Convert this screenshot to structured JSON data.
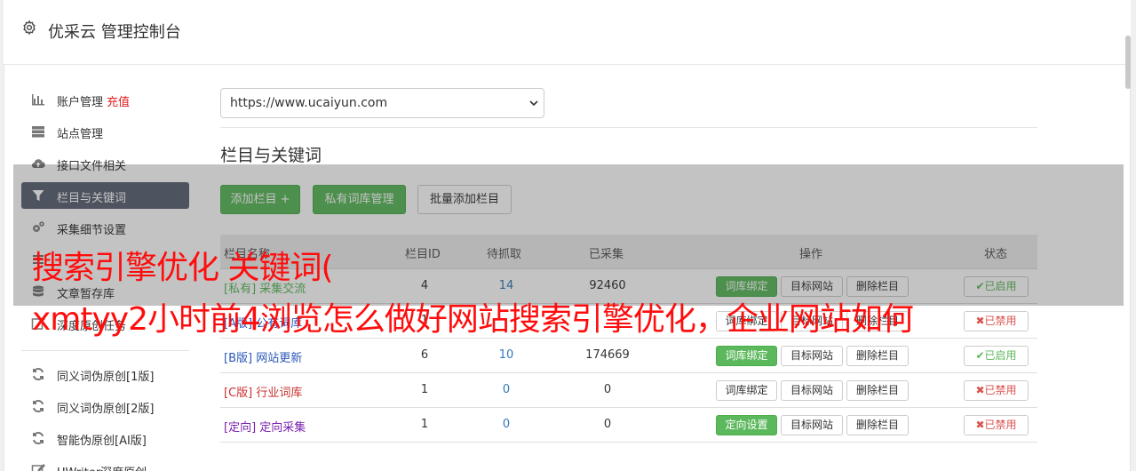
{
  "header": {
    "title": "优采云 管理控制台",
    "icon": "gear-icon"
  },
  "sidebar": {
    "items": [
      {
        "label": "账户管理",
        "extra": "充值",
        "icon": "bar-chart-icon"
      },
      {
        "label": "站点管理",
        "icon": "server-icon"
      },
      {
        "label": "接口文件相关",
        "icon": "cloud-upload-icon"
      },
      {
        "label": "栏目与关键词",
        "icon": "filter-icon",
        "active": true
      },
      {
        "label": "采集细节设置",
        "icon": "cogs-icon"
      },
      {
        "label": "",
        "icon": "list-icon"
      },
      {
        "label": "文章暂存库",
        "icon": "database-icon"
      },
      {
        "label": "深度原创任务",
        "icon": "edit-icon"
      },
      {
        "label": "同义词伪原创[1版]",
        "icon": "refresh-icon"
      },
      {
        "label": "同义词伪原创[2版]",
        "icon": "refresh-icon"
      },
      {
        "label": "智能伪原创[AI版]",
        "icon": "refresh-icon"
      },
      {
        "label": "UWriter深度原创",
        "icon": "pencil-icon"
      }
    ]
  },
  "site_select": {
    "value": "https://www.ucaiyun.com"
  },
  "section": {
    "title": "栏目与关键词"
  },
  "toolbar": {
    "add_column": "添加栏目 +",
    "private_lib": "私有词库管理",
    "batch_add": "批量添加栏目"
  },
  "table": {
    "headers": {
      "name": "栏目名称",
      "id": "栏目ID",
      "pending": "待抓取",
      "collected": "已采集",
      "ops": "操作",
      "status": "状态"
    },
    "rows": [
      {
        "tag": "[私有]",
        "name": "采集交流",
        "id": "4",
        "pending": "14",
        "collected": "92460",
        "op1": "词库绑定",
        "op1_green": true,
        "op2": "目标网站",
        "op3": "删除栏目",
        "status": "✔已启用",
        "status_on": true,
        "tag_color": "#5cb85c"
      },
      {
        "tag": "[A版]",
        "name": "公有词库",
        "id": "1",
        "pending": "",
        "collected": "",
        "op1": "词库绑定",
        "op1_green": false,
        "op2": "目标网站",
        "op3": "删除栏目",
        "status": "✖已禁用",
        "status_on": false,
        "tag_color": "#2a57b8"
      },
      {
        "tag": "[B版]",
        "name": "网站更新",
        "id": "6",
        "pending": "10",
        "collected": "174669",
        "op1": "词库绑定",
        "op1_green": true,
        "op2": "目标网站",
        "op3": "删除栏目",
        "status": "✔已启用",
        "status_on": true,
        "tag_color": "#2a57b8"
      },
      {
        "tag": "[C版]",
        "name": "行业词库",
        "id": "1",
        "pending": "0",
        "collected": "0",
        "op1": "词库绑定",
        "op1_green": false,
        "op2": "目标网站",
        "op3": "删除栏目",
        "status": "✖已禁用",
        "status_on": false,
        "tag_color": "#c9302c"
      },
      {
        "tag": "[定向]",
        "name": "定向采集",
        "id": "1",
        "pending": "0",
        "collected": "0",
        "op1": "定向设置",
        "op1_green": true,
        "op2": "目标网站",
        "op3": "删除栏目",
        "status": "✖已禁用",
        "status_on": false,
        "tag_color": "#7a1fb0"
      }
    ]
  },
  "overlay": {
    "line1": "搜索引擎优化 关键词(",
    "line2": "xmtyy2小时前4浏览怎么做好网站搜索引擎优化，企业网站如何"
  }
}
